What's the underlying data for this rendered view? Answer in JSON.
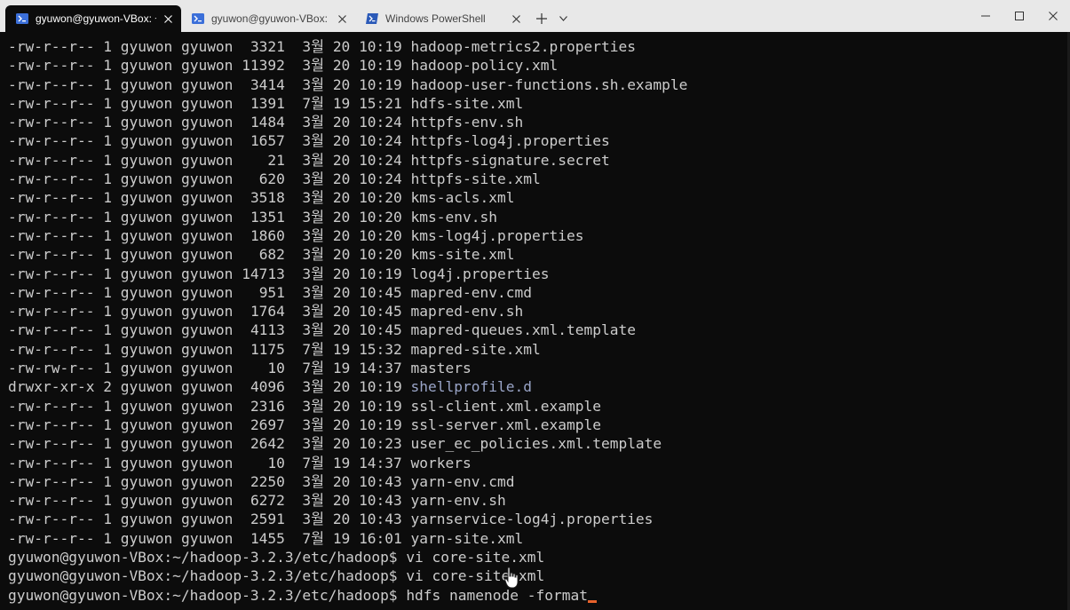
{
  "tabs": [
    {
      "label": "gyuwon@gyuwon-VBox: ~/h",
      "active": true,
      "icon": "linux-terminal-icon"
    },
    {
      "label": "gyuwon@gyuwon-VBox: ~/ha",
      "active": false,
      "icon": "linux-terminal-icon"
    },
    {
      "label": "Windows PowerShell",
      "active": false,
      "icon": "powershell-icon"
    }
  ],
  "titlebar": {
    "new_tab": "+",
    "dropdown": "⌄"
  },
  "terminal": {
    "listing": [
      {
        "perm": "-rw-r--r--",
        "links": "1",
        "owner": "gyuwon",
        "group": "gyuwon",
        "size": "3321",
        "month": "3월",
        "day": "20",
        "time": "10:19",
        "name": "hadoop-metrics2.properties"
      },
      {
        "perm": "-rw-r--r--",
        "links": "1",
        "owner": "gyuwon",
        "group": "gyuwon",
        "size": "11392",
        "month": "3월",
        "day": "20",
        "time": "10:19",
        "name": "hadoop-policy.xml"
      },
      {
        "perm": "-rw-r--r--",
        "links": "1",
        "owner": "gyuwon",
        "group": "gyuwon",
        "size": "3414",
        "month": "3월",
        "day": "20",
        "time": "10:19",
        "name": "hadoop-user-functions.sh.example"
      },
      {
        "perm": "-rw-r--r--",
        "links": "1",
        "owner": "gyuwon",
        "group": "gyuwon",
        "size": "1391",
        "month": "7월",
        "day": "19",
        "time": "15:21",
        "name": "hdfs-site.xml"
      },
      {
        "perm": "-rw-r--r--",
        "links": "1",
        "owner": "gyuwon",
        "group": "gyuwon",
        "size": "1484",
        "month": "3월",
        "day": "20",
        "time": "10:24",
        "name": "httpfs-env.sh"
      },
      {
        "perm": "-rw-r--r--",
        "links": "1",
        "owner": "gyuwon",
        "group": "gyuwon",
        "size": "1657",
        "month": "3월",
        "day": "20",
        "time": "10:24",
        "name": "httpfs-log4j.properties"
      },
      {
        "perm": "-rw-r--r--",
        "links": "1",
        "owner": "gyuwon",
        "group": "gyuwon",
        "size": "21",
        "month": "3월",
        "day": "20",
        "time": "10:24",
        "name": "httpfs-signature.secret"
      },
      {
        "perm": "-rw-r--r--",
        "links": "1",
        "owner": "gyuwon",
        "group": "gyuwon",
        "size": "620",
        "month": "3월",
        "day": "20",
        "time": "10:24",
        "name": "httpfs-site.xml"
      },
      {
        "perm": "-rw-r--r--",
        "links": "1",
        "owner": "gyuwon",
        "group": "gyuwon",
        "size": "3518",
        "month": "3월",
        "day": "20",
        "time": "10:20",
        "name": "kms-acls.xml"
      },
      {
        "perm": "-rw-r--r--",
        "links": "1",
        "owner": "gyuwon",
        "group": "gyuwon",
        "size": "1351",
        "month": "3월",
        "day": "20",
        "time": "10:20",
        "name": "kms-env.sh"
      },
      {
        "perm": "-rw-r--r--",
        "links": "1",
        "owner": "gyuwon",
        "group": "gyuwon",
        "size": "1860",
        "month": "3월",
        "day": "20",
        "time": "10:20",
        "name": "kms-log4j.properties"
      },
      {
        "perm": "-rw-r--r--",
        "links": "1",
        "owner": "gyuwon",
        "group": "gyuwon",
        "size": "682",
        "month": "3월",
        "day": "20",
        "time": "10:20",
        "name": "kms-site.xml"
      },
      {
        "perm": "-rw-r--r--",
        "links": "1",
        "owner": "gyuwon",
        "group": "gyuwon",
        "size": "14713",
        "month": "3월",
        "day": "20",
        "time": "10:19",
        "name": "log4j.properties"
      },
      {
        "perm": "-rw-r--r--",
        "links": "1",
        "owner": "gyuwon",
        "group": "gyuwon",
        "size": "951",
        "month": "3월",
        "day": "20",
        "time": "10:45",
        "name": "mapred-env.cmd"
      },
      {
        "perm": "-rw-r--r--",
        "links": "1",
        "owner": "gyuwon",
        "group": "gyuwon",
        "size": "1764",
        "month": "3월",
        "day": "20",
        "time": "10:45",
        "name": "mapred-env.sh"
      },
      {
        "perm": "-rw-r--r--",
        "links": "1",
        "owner": "gyuwon",
        "group": "gyuwon",
        "size": "4113",
        "month": "3월",
        "day": "20",
        "time": "10:45",
        "name": "mapred-queues.xml.template"
      },
      {
        "perm": "-rw-r--r--",
        "links": "1",
        "owner": "gyuwon",
        "group": "gyuwon",
        "size": "1175",
        "month": "7월",
        "day": "19",
        "time": "15:32",
        "name": "mapred-site.xml"
      },
      {
        "perm": "-rw-rw-r--",
        "links": "1",
        "owner": "gyuwon",
        "group": "gyuwon",
        "size": "10",
        "month": "7월",
        "day": "19",
        "time": "14:37",
        "name": "masters"
      },
      {
        "perm": "drwxr-xr-x",
        "links": "2",
        "owner": "gyuwon",
        "group": "gyuwon",
        "size": "4096",
        "month": "3월",
        "day": "20",
        "time": "10:19",
        "name": "shellprofile.d",
        "is_dir": true
      },
      {
        "perm": "-rw-r--r--",
        "links": "1",
        "owner": "gyuwon",
        "group": "gyuwon",
        "size": "2316",
        "month": "3월",
        "day": "20",
        "time": "10:19",
        "name": "ssl-client.xml.example"
      },
      {
        "perm": "-rw-r--r--",
        "links": "1",
        "owner": "gyuwon",
        "group": "gyuwon",
        "size": "2697",
        "month": "3월",
        "day": "20",
        "time": "10:19",
        "name": "ssl-server.xml.example"
      },
      {
        "perm": "-rw-r--r--",
        "links": "1",
        "owner": "gyuwon",
        "group": "gyuwon",
        "size": "2642",
        "month": "3월",
        "day": "20",
        "time": "10:23",
        "name": "user_ec_policies.xml.template"
      },
      {
        "perm": "-rw-r--r--",
        "links": "1",
        "owner": "gyuwon",
        "group": "gyuwon",
        "size": "10",
        "month": "7월",
        "day": "19",
        "time": "14:37",
        "name": "workers"
      },
      {
        "perm": "-rw-r--r--",
        "links": "1",
        "owner": "gyuwon",
        "group": "gyuwon",
        "size": "2250",
        "month": "3월",
        "day": "20",
        "time": "10:43",
        "name": "yarn-env.cmd"
      },
      {
        "perm": "-rw-r--r--",
        "links": "1",
        "owner": "gyuwon",
        "group": "gyuwon",
        "size": "6272",
        "month": "3월",
        "day": "20",
        "time": "10:43",
        "name": "yarn-env.sh"
      },
      {
        "perm": "-rw-r--r--",
        "links": "1",
        "owner": "gyuwon",
        "group": "gyuwon",
        "size": "2591",
        "month": "3월",
        "day": "20",
        "time": "10:43",
        "name": "yarnservice-log4j.properties"
      },
      {
        "perm": "-rw-r--r--",
        "links": "1",
        "owner": "gyuwon",
        "group": "gyuwon",
        "size": "1455",
        "month": "7월",
        "day": "19",
        "time": "16:01",
        "name": "yarn-site.xml"
      }
    ],
    "prompt_lines": [
      {
        "prompt": "gyuwon@gyuwon-VBox:~/hadoop-3.2.3/etc/hadoop$",
        "command": "vi core-site.xml"
      },
      {
        "prompt": "gyuwon@gyuwon-VBox:~/hadoop-3.2.3/etc/hadoop$",
        "command": "vi core-site.xml"
      },
      {
        "prompt": "gyuwon@gyuwon-VBox:~/hadoop-3.2.3/etc/hadoop$",
        "command": "hdfs namenode -format",
        "current": true
      }
    ]
  },
  "colors": {
    "background": "#0c0c0c",
    "foreground": "#cccccc",
    "directory": "#9aa5c8",
    "cursor": "#e8622c",
    "titlebar": "#e8e8e8",
    "tab_icon": "#3b6fd9"
  }
}
